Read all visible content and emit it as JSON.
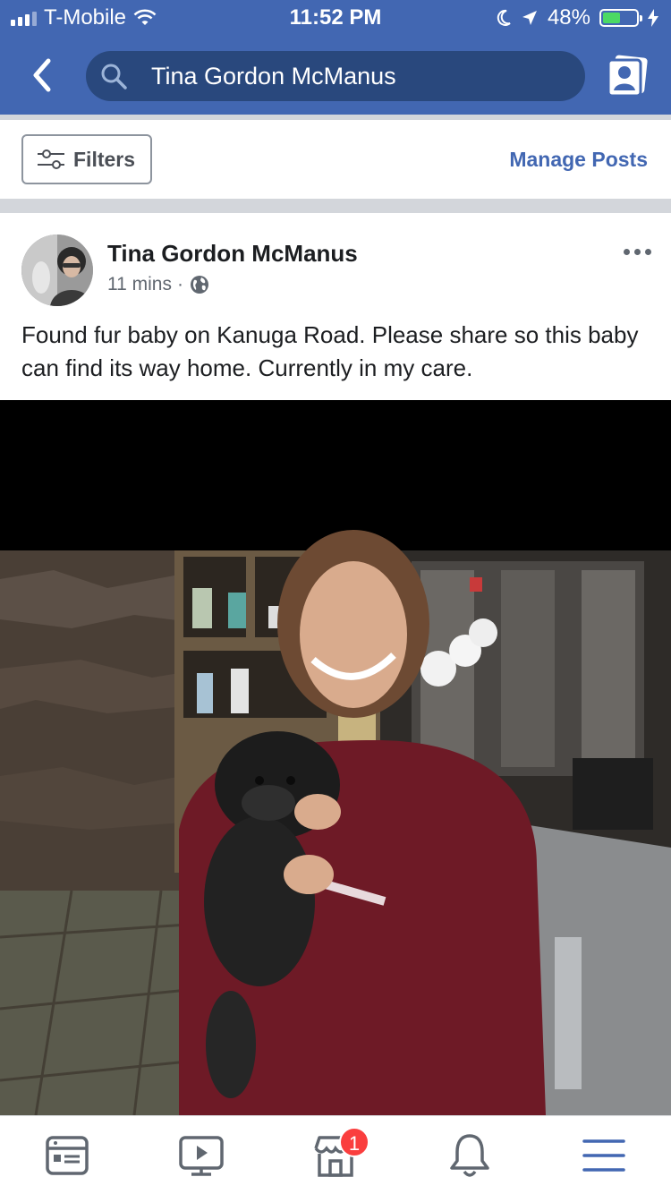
{
  "status_bar": {
    "carrier": "T-Mobile",
    "time": "11:52 PM",
    "battery_percent": "48%",
    "battery_level": 0.48
  },
  "search": {
    "query": "Tina Gordon McManus"
  },
  "toolbar": {
    "filters_label": "Filters",
    "manage_posts_label": "Manage Posts"
  },
  "post": {
    "author": "Tina Gordon McManus",
    "time_ago": "11 mins",
    "separator": "·",
    "privacy_icon": "globe-icon",
    "text": "Found fur baby on Kanuga Road. Please share so this baby can find its way home. Currently in my care."
  },
  "bottom_nav": {
    "items": [
      {
        "icon": "news-feed-icon"
      },
      {
        "icon": "watch-video-icon"
      },
      {
        "icon": "marketplace-icon",
        "badge": "1"
      },
      {
        "icon": "notifications-bell-icon"
      },
      {
        "icon": "menu-icon"
      }
    ]
  },
  "colors": {
    "brand": "#4267b2",
    "search_bg": "#29487d",
    "badge": "#fa3e3e",
    "battery": "#4cd964"
  }
}
